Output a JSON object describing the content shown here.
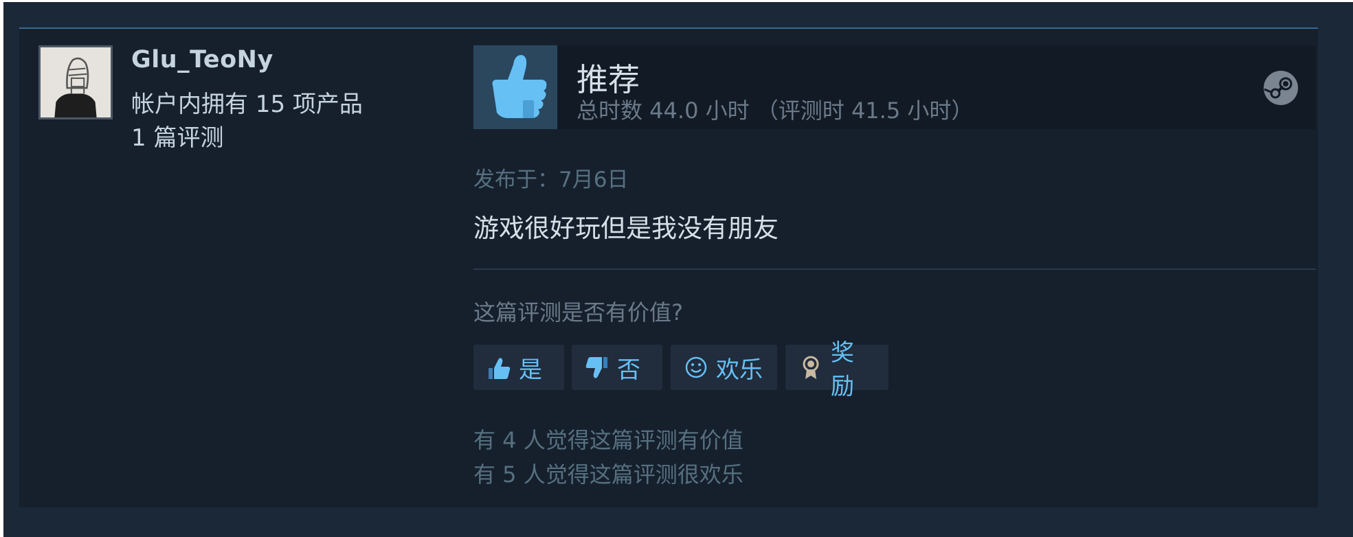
{
  "reviewer": {
    "username": "Glu_TeoNy",
    "products_owned": "帐户内拥有 15 项产品",
    "review_count": "1 篇评测"
  },
  "review": {
    "verdict": "推荐",
    "hours": "总时数 44.0 小时 （评测时 41.5 小时）",
    "posted": "发布于：7月6日",
    "text": "游戏很好玩但是我没有朋友"
  },
  "feedback": {
    "question": "这篇评测是否有价值?",
    "yes_label": "是",
    "no_label": "否",
    "funny_label": "欢乐",
    "award_label": "奖励",
    "helpful_stat": "有 4 人觉得这篇评测有价值",
    "funny_stat": "有 5 人觉得这篇评测很欢乐"
  },
  "icons": {
    "verdict": "thumbs-up-icon",
    "platform": "steam-logo-icon",
    "yes": "thumbs-up-icon",
    "no": "thumbs-down-icon",
    "funny": "smiley-icon",
    "award": "award-ribbon-icon"
  },
  "colors": {
    "background": "#1b2838",
    "card": "#16202d",
    "accent": "#66c0f4",
    "text_light": "#c6d4df",
    "text_muted": "#6b7a89"
  }
}
